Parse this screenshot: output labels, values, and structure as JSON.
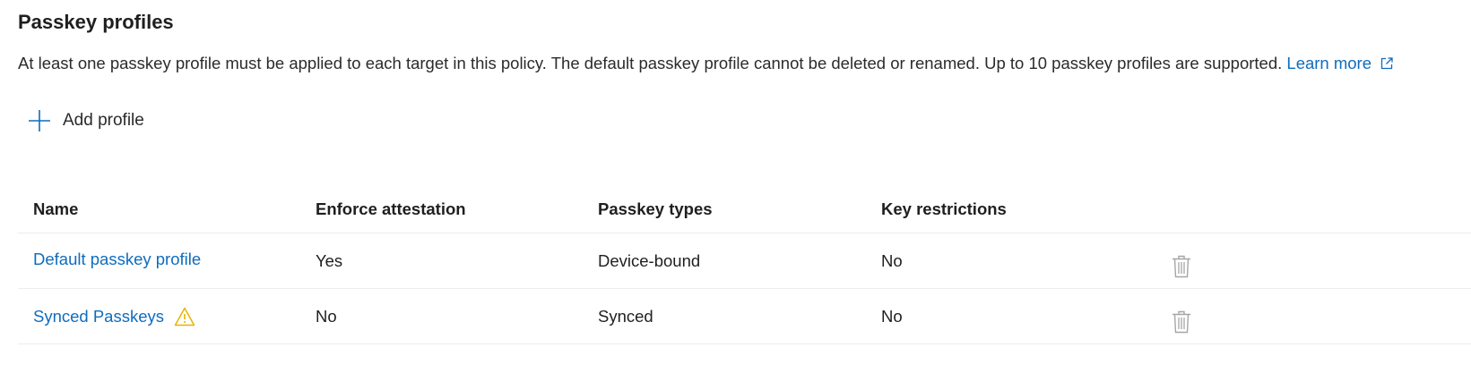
{
  "section": {
    "title": "Passkey profiles",
    "description": "At least one passkey profile must be applied to each target in this policy. The default passkey profile cannot be deleted or renamed. Up to 10 passkey profiles are supported.",
    "learn_more": "Learn more",
    "learn_more_icon": "external-link-icon"
  },
  "toolbar": {
    "add_profile_label": "Add profile",
    "add_profile_icon": "plus-icon"
  },
  "table": {
    "headers": [
      "Name",
      "Enforce attestation",
      "Passkey types",
      "Key restrictions"
    ],
    "rows": [
      {
        "name": "Default passkey profile",
        "enforce_attestation": "Yes",
        "passkey_types": "Device-bound",
        "key_restrictions": "No",
        "warning": false,
        "action_icon": "trash-icon"
      },
      {
        "name": "Synced Passkeys",
        "enforce_attestation": "No",
        "passkey_types": "Synced",
        "key_restrictions": "No",
        "warning": true,
        "warning_icon": "warning-icon",
        "action_icon": "trash-icon"
      }
    ]
  },
  "colors": {
    "link": "#0f6cbd",
    "warning": "#f2c811",
    "icon_disabled": "#a6a6a6",
    "divider": "#ececec"
  }
}
